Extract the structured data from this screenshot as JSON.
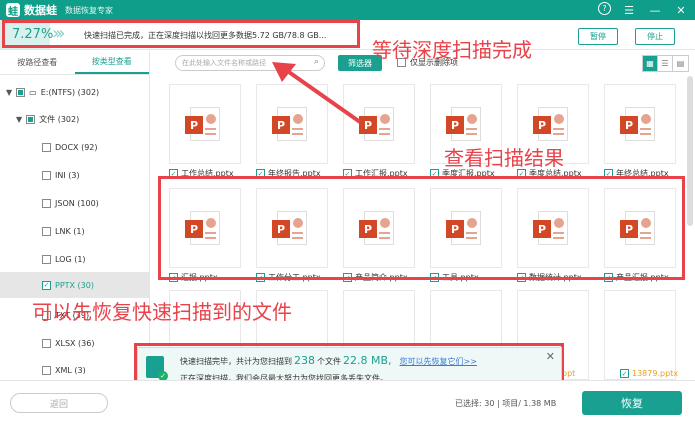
{
  "app": {
    "logo_char": "蛙",
    "name": "数据蛙",
    "subtitle": "数据恢复专家"
  },
  "window_icons": {
    "help": "?",
    "menu": "☰",
    "minimize": "—",
    "close": "✕"
  },
  "progress": {
    "percent_text": "7.27%",
    "percent_value": 7.27,
    "message": "快速扫描已完成，正在深度扫描以找回更多数据5.72 GB/78.8 GB...",
    "pause_label": "暂停",
    "stop_label": "停止"
  },
  "annotations": {
    "wait_deep": "等待深度扫描完成",
    "view_results": "查看扫描结果",
    "recover_first": "可以先恢复快速扫描到的文件"
  },
  "sidebar": {
    "tabs": [
      {
        "label": "按路径查看"
      },
      {
        "label": "按类型查看"
      }
    ],
    "tree": [
      {
        "label": "E:(NTFS) (302)"
      },
      {
        "label": "文件 (302)"
      },
      {
        "label": "DOCX (92)"
      },
      {
        "label": "INI (3)"
      },
      {
        "label": "JSON (100)"
      },
      {
        "label": "LNK (1)"
      },
      {
        "label": "LOG (1)"
      },
      {
        "label": "PPTX (30)"
      },
      {
        "label": "TXT (39)"
      },
      {
        "label": "XLSX (36)"
      },
      {
        "label": "XML (3)"
      }
    ]
  },
  "toolbar": {
    "search_placeholder": "在此处输入文件名称或路径",
    "filter_label": "筛选器",
    "deleted_only_label": "仅显示删除项"
  },
  "files": {
    "row1": [
      "工作总结.pptx",
      "年终报告.pptx",
      "工作汇报.pptx",
      "季度汇报.pptx",
      "季度总结.pptx",
      "年终总结.pptx"
    ],
    "row2": [
      "汇报.pptx",
      "工作分工.pptx",
      "产品简介.pptx",
      "工具.pptx",
      "数据统计.pptx",
      "产品汇报.pptx"
    ],
    "row3_partial": [
      "ppt",
      "13879.pptx"
    ]
  },
  "toast": {
    "prefix": "快速扫描完毕，共计为您扫描到",
    "count": "238",
    "mid": "个文件",
    "size": "22.8 MB,",
    "link": "您可以先恢复它们>>",
    "line2": "正在深度扫描，我们会尽最大努力为您找回更多丢失文件。",
    "close": "✕"
  },
  "bottom": {
    "back_label": "返回",
    "status": "已选择: 30 | 项目/ 1.38 MB",
    "recover_label": "恢复"
  },
  "colors": {
    "brand": "#0f9e8a",
    "accent": "#1aa090",
    "annotation": "#e8424a",
    "ppt": "#d24726"
  }
}
